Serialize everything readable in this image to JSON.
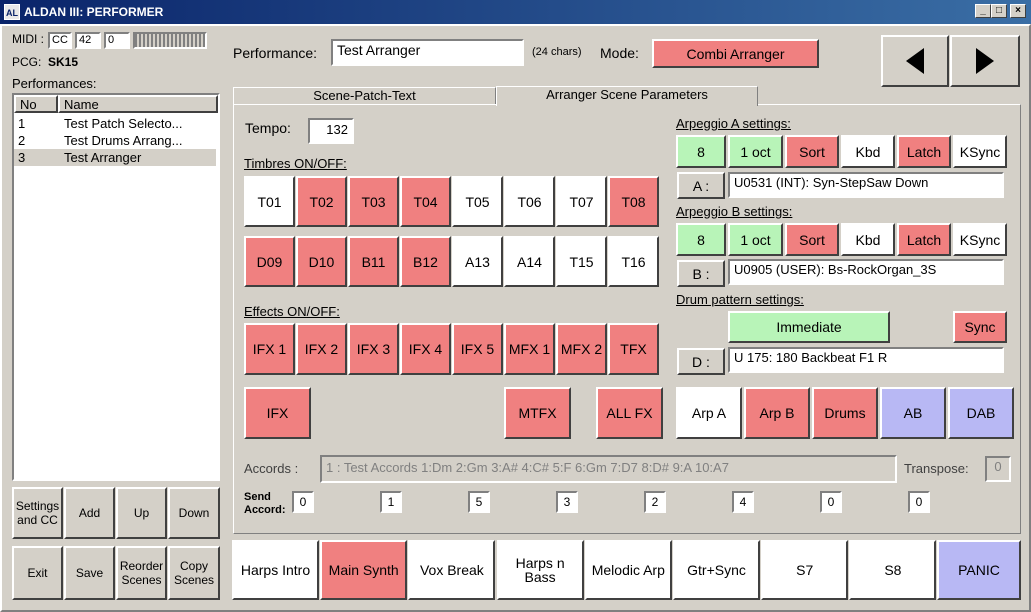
{
  "window": {
    "title": "ALDAN III: PERFORMER",
    "icon_text": "AL"
  },
  "midi": {
    "label": "MIDI :",
    "type": "CC",
    "number": "42",
    "value": "0"
  },
  "pcg": {
    "label": "PCG:",
    "value": "SK15"
  },
  "performances": {
    "label": "Performances:",
    "headers": [
      "No",
      "Name"
    ],
    "rows": [
      {
        "no": "1",
        "name": "Test Patch Selecto..."
      },
      {
        "no": "2",
        "name": "Test Drums Arrang..."
      },
      {
        "no": "3",
        "name": "Test Arranger"
      }
    ]
  },
  "left_buttons": {
    "settings": "Settings and CC",
    "add": "Add",
    "up": "Up",
    "down": "Down",
    "exit": "Exit",
    "save": "Save",
    "reorder": "Reorder Scenes",
    "copy": "Copy Scenes"
  },
  "header": {
    "performance_label": "Performance:",
    "performance_value": "Test Arranger",
    "chars": "(24 chars)",
    "mode_label": "Mode:",
    "mode_value": "Combi Arranger"
  },
  "tabs": {
    "tab1": "Scene-Patch-Text",
    "tab2": "Arranger Scene Parameters"
  },
  "tempo": {
    "label": "Tempo:",
    "value": "132"
  },
  "timbres": {
    "label": "Timbres ON/OFF:",
    "row1": [
      {
        "label": "T01",
        "on": false
      },
      {
        "label": "T02",
        "on": true
      },
      {
        "label": "T03",
        "on": true
      },
      {
        "label": "T04",
        "on": true
      },
      {
        "label": "T05",
        "on": false
      },
      {
        "label": "T06",
        "on": false
      },
      {
        "label": "T07",
        "on": false
      },
      {
        "label": "T08",
        "on": true
      }
    ],
    "row2": [
      {
        "label": "D09",
        "on": true
      },
      {
        "label": "D10",
        "on": true
      },
      {
        "label": "B11",
        "on": true
      },
      {
        "label": "B12",
        "on": true
      },
      {
        "label": "A13",
        "on": false
      },
      {
        "label": "A14",
        "on": false
      },
      {
        "label": "T15",
        "on": false
      },
      {
        "label": "T16",
        "on": false
      }
    ]
  },
  "effects": {
    "label": "Effects ON/OFF:",
    "items": [
      "IFX 1",
      "IFX 2",
      "IFX 3",
      "IFX 4",
      "IFX 5",
      "MFX 1",
      "MFX 2",
      "TFX"
    ],
    "ifx": "IFX",
    "mtfx": "MTFX",
    "allfx": "ALL FX"
  },
  "arp_a": {
    "label": "Arpeggio A settings:",
    "buttons": [
      "8",
      "1 oct",
      "Sort",
      "Kbd",
      "Latch",
      "KSync"
    ],
    "key": "A :",
    "pattern": "U0531 (INT): Syn-StepSaw Down"
  },
  "arp_b": {
    "label": "Arpeggio B settings:",
    "buttons": [
      "8",
      "1 oct",
      "Sort",
      "Kbd",
      "Latch",
      "KSync"
    ],
    "key": "B :",
    "pattern": "U0905 (USER): Bs-RockOrgan_3S"
  },
  "drum": {
    "label": "Drum pattern settings:",
    "immediate": "Immediate",
    "sync": "Sync",
    "key": "D :",
    "pattern": "U 175: 180 Backbeat F1 R"
  },
  "arp_select": [
    "Arp A",
    "Arp B",
    "Drums",
    "AB",
    "DAB"
  ],
  "accords": {
    "label": "Accords :",
    "value": "1 : Test Accords 1:Dm  2:Gm  3:A#  4:C#  5:F  6:Gm  7:D7  8:D#  9:A 10:A7",
    "transpose_label": "Transpose:",
    "transpose_value": "0",
    "send_label": "Send Accord:",
    "send_values": [
      "0",
      "1",
      "5",
      "3",
      "2",
      "4",
      "0",
      "0"
    ]
  },
  "scenes": [
    "Harps Intro",
    "Main Synth",
    "Vox Break",
    "Harps n Bass",
    "Melodic Arp",
    "Gtr+Sync",
    "S7",
    "S8"
  ],
  "panic": "PANIC",
  "colors": {
    "on": "#f08080",
    "green": "#b8f4b8",
    "purple": "#b8b8f4",
    "title": "#0a246a"
  }
}
